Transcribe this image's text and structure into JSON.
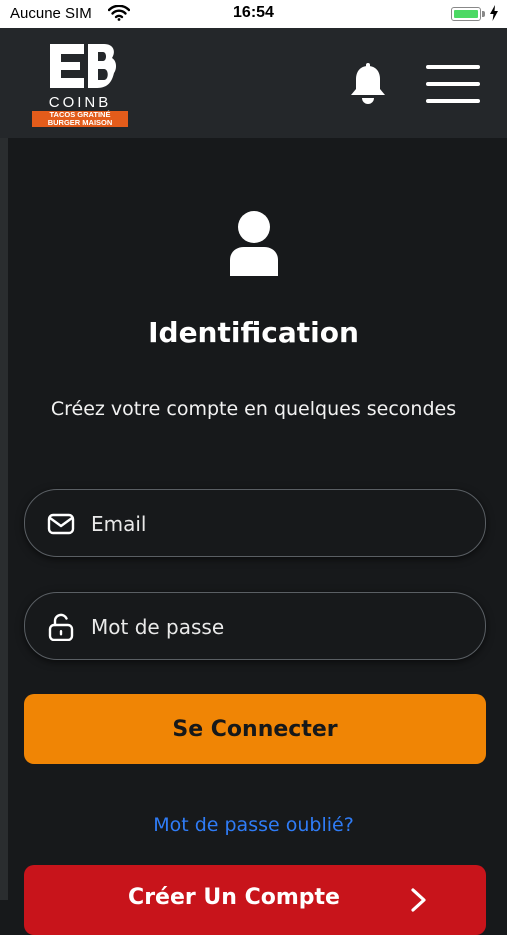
{
  "status_bar": {
    "carrier": "Aucune SIM",
    "time": "16:54",
    "battery_level": 1.0
  },
  "header": {
    "logo": {
      "name": "COINB",
      "tagline_1": "TACOS GRATINÉ",
      "tagline_2": "BURGER MAISON"
    },
    "icons": [
      "bell-icon",
      "hamburger-menu-icon"
    ]
  },
  "login": {
    "title": "Identification",
    "subtitle": "Créez votre compte en quelques secondes",
    "email_placeholder": "Email",
    "password_placeholder": "Mot de passe",
    "login_label": "Se Connecter",
    "forgot_label": "Mot de passe oublié?",
    "create_label": "Créer Un Compte"
  },
  "colors": {
    "background": "#17191b",
    "header": "#24272a",
    "primary": "#f08505",
    "danger": "#c8141b",
    "link": "#2f7cf6"
  }
}
